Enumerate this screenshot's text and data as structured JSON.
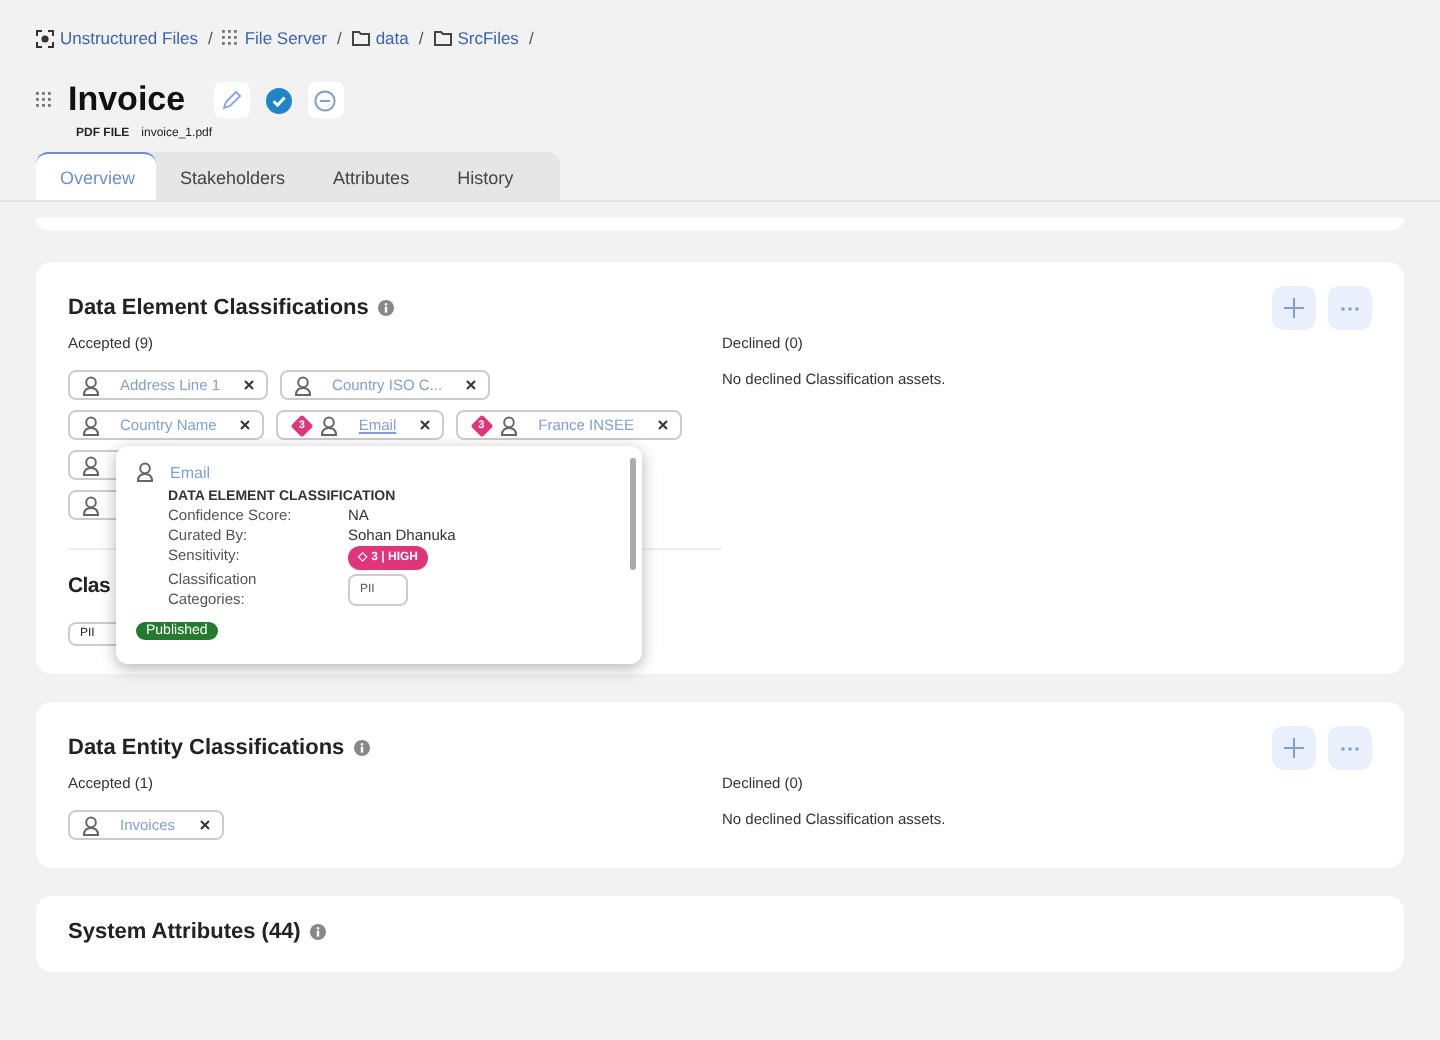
{
  "breadcrumbs": [
    {
      "label": "Unstructured Files",
      "kind": "scan",
      "separator": "/"
    },
    {
      "label": "File Server",
      "kind": "grid",
      "separator": "/"
    },
    {
      "label": "data",
      "kind": "folder",
      "separator": "/"
    },
    {
      "label": "SrcFiles",
      "kind": "folder",
      "separator": "/"
    }
  ],
  "asset": {
    "title": "Invoice",
    "type": "PDF FILE",
    "file": "invoice_1.pdf",
    "certified": true
  },
  "tabs": [
    {
      "label": "Overview",
      "selected": true
    },
    {
      "label": "Stakeholders",
      "selected": false
    },
    {
      "label": "Attributes",
      "selected": false
    },
    {
      "label": "History",
      "selected": false
    }
  ],
  "element_classifications": {
    "title": "Data Element Classifications",
    "accepted_label": "Accepted (9)",
    "declined_label": "Declined (0)",
    "declined_empty": "No declined Classification assets.",
    "chips": [
      {
        "label": "Address Line 1",
        "hovered": false
      },
      {
        "label": "Country ISO C...",
        "hovered": false
      },
      {
        "label": "Country Name",
        "hovered": false
      },
      {
        "label": "Email",
        "sensitivity": "3",
        "hovered": true
      },
      {
        "label": "France INSEE",
        "sensitivity": "3",
        "hovered": false
      }
    ],
    "covered_chips": [
      {
        "kind": "covered"
      },
      {
        "kind": "covered"
      }
    ],
    "categories_heading": "Clas",
    "categories": [
      "PII"
    ],
    "tooltip": {
      "name": "Email",
      "heading": "DATA ELEMENT CLASSIFICATION",
      "rows": [
        {
          "label": "Confidence Score:",
          "value": "NA",
          "kind": "text"
        },
        {
          "label": "Curated By:",
          "value": "Sohan Dhanuka",
          "kind": "text"
        },
        {
          "label": "Sensitivity:",
          "value": "◇ 3 | HIGH",
          "kind": "badge"
        },
        {
          "label": "Classification Categories:",
          "value": "PII",
          "kind": "tag"
        }
      ],
      "status": "Published"
    }
  },
  "entity_classifications": {
    "title": "Data Entity Classifications",
    "accepted_label": "Accepted (1)",
    "declined_label": "Declined (0)",
    "declined_empty": "No declined Classification assets.",
    "chips": [
      {
        "label": "Invoices"
      }
    ]
  },
  "system_attributes": {
    "title": "System Attributes (44)"
  }
}
